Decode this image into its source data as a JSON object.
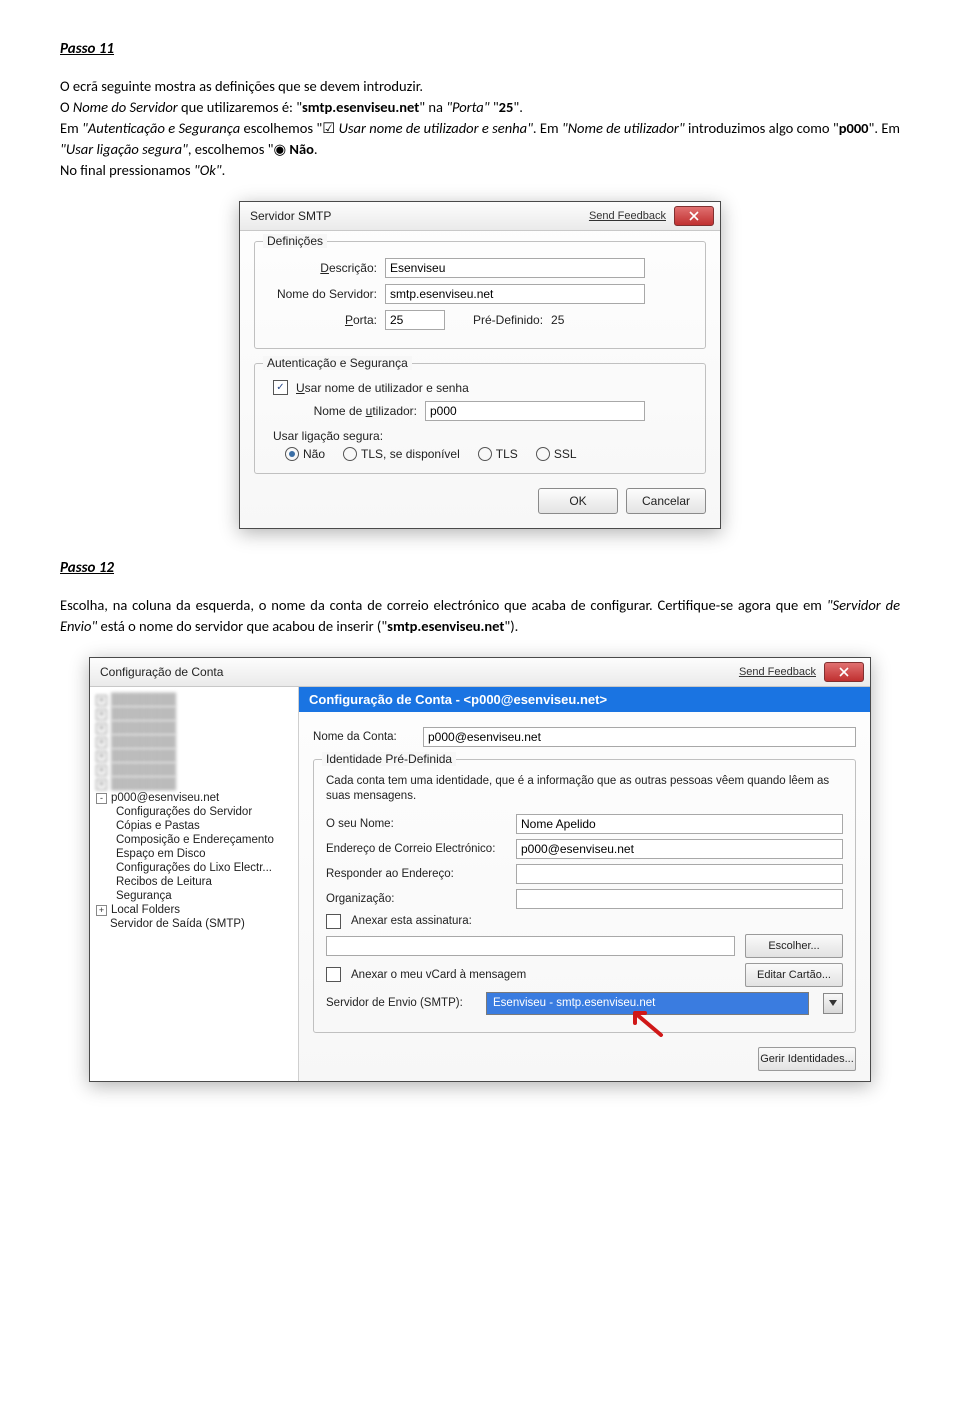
{
  "step11": {
    "title": "Passo 11",
    "paragraph_html": "O ecrã seguinte mostra as definições que se devem introduzir.\nO <i>Nome do Servidor</i> que utilizaremos é: \"<b>smtp.esenviseu.net</b>\" na <i>\"Porta\"</i> \"<b>25</b>\".\nEm <i>\"Autenticação e Segurança</i> escolhemos \"☑ <i>Usar nome de utilizador e senha\"</i>. Em <i>\"Nome de utilizador\"</i> introduzimos algo como \"<b>p000</b>\". Em <i>\"Usar ligação segura\"</i>, escolhemos \"◉ <b>Não</b>.\nNo final pressionamos <i>\"Ok\"</i>."
  },
  "dlg1": {
    "title": "Servidor SMTP",
    "feedback": "Send Feedback",
    "group_defs": "Definições",
    "desc_label": "Descrição:",
    "desc_value": "Esenviseu",
    "server_label": "Nome do Servidor:",
    "server_value": "smtp.esenviseu.net",
    "port_label": "Porta:",
    "port_value": "25",
    "predef_label": "Pré-Definido:",
    "predef_value": "25",
    "group_auth": "Autenticação e Segurança",
    "chk_user": "Usar nome de utilizador e senha",
    "user_label": "Nome de utilizador:",
    "user_value": "p000",
    "secure_label": "Usar ligação segura:",
    "r_no": "Não",
    "r_tlsif": "TLS, se disponível",
    "r_tls": "TLS",
    "r_ssl": "SSL",
    "ok": "OK",
    "cancel": "Cancelar"
  },
  "step12": {
    "title": "Passo 12",
    "paragraph_html": "Escolha, na coluna da esquerda, o nome da conta de correio electrónico que acaba de configurar. Certifique-se agora que em <i>\"Servidor de Envio\"</i> está o nome do servidor que acabou de inserir (\"<b>smtp.esenviseu.net</b>\")."
  },
  "dlg2": {
    "title": "Configuração de Conta",
    "feedback": "Send Feedback",
    "sidebar": {
      "acct": "p000@esenviseu.net",
      "items": [
        "Configurações do Servidor",
        "Cópias e Pastas",
        "Composição e Endereçamento",
        "Espaço em Disco",
        "Configurações do Lixo Electr...",
        "Recibos de Leitura",
        "Segurança"
      ],
      "local": "Local Folders",
      "out": "Servidor de Saída (SMTP)"
    },
    "header": "Configuração de Conta - <p000@esenviseu.net>",
    "acct_name_label": "Nome da Conta:",
    "acct_name_value": "p000@esenviseu.net",
    "ident_group": "Identidade Pré-Definida",
    "ident_desc": "Cada conta tem uma identidade, que é a informação que as outras pessoas vêem quando lêem as suas mensagens.",
    "name_label": "O seu Nome:",
    "name_value": "Nome Apelido",
    "email_label": "Endereço de Correio Electrónico:",
    "email_value": "p000@esenviseu.net",
    "reply_label": "Responder ao Endereço:",
    "org_label": "Organização:",
    "attach_sig": "Anexar esta assinatura:",
    "choose": "Escolher...",
    "attach_vcard": "Anexar o meu vCard à mensagem",
    "edit_card": "Editar Cartão...",
    "send_server_label": "Servidor de Envio (SMTP):",
    "send_server_value": "Esenviseu - smtp.esenviseu.net",
    "manage_ident": "Gerir Identidades..."
  }
}
